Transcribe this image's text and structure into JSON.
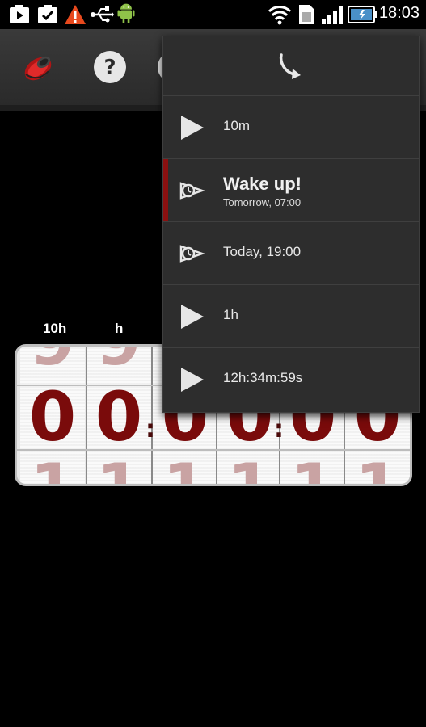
{
  "status_bar": {
    "time": "18:03",
    "icons": [
      "media-notification-icon",
      "download-complete-icon",
      "warning-icon",
      "usb-icon",
      "android-debug-icon",
      "wifi-icon",
      "sim-icon",
      "signal-icon",
      "battery-icon"
    ]
  },
  "action_bar": {
    "buttons": [
      "alarm-sound-icon",
      "help-icon"
    ]
  },
  "dial": {
    "labels": [
      "10h",
      "h"
    ],
    "digits": [
      "0",
      "0",
      "0",
      "0",
      "0",
      "0"
    ],
    "ghost_above": "9",
    "ghost_below": "1"
  },
  "menu": {
    "header_icon": "call-return-icon",
    "items": [
      {
        "type": "preset",
        "icon": "play-icon",
        "label": "10m"
      },
      {
        "type": "alarm",
        "icon": "alarm-clock-icon",
        "title": "Wake up!",
        "subtitle": "Tomorrow, 07:00",
        "selected": true
      },
      {
        "type": "alarm",
        "icon": "alarm-clock-icon",
        "label": "Today, 19:00"
      },
      {
        "type": "preset",
        "icon": "play-icon",
        "label": "1h"
      },
      {
        "type": "preset",
        "icon": "play-icon",
        "label": "12h:34m:59s"
      }
    ]
  },
  "colors": {
    "digit": "#7a0b0b",
    "selected_bar": "#8a1010",
    "warning": "#e8491d",
    "android": "#8fc249"
  }
}
